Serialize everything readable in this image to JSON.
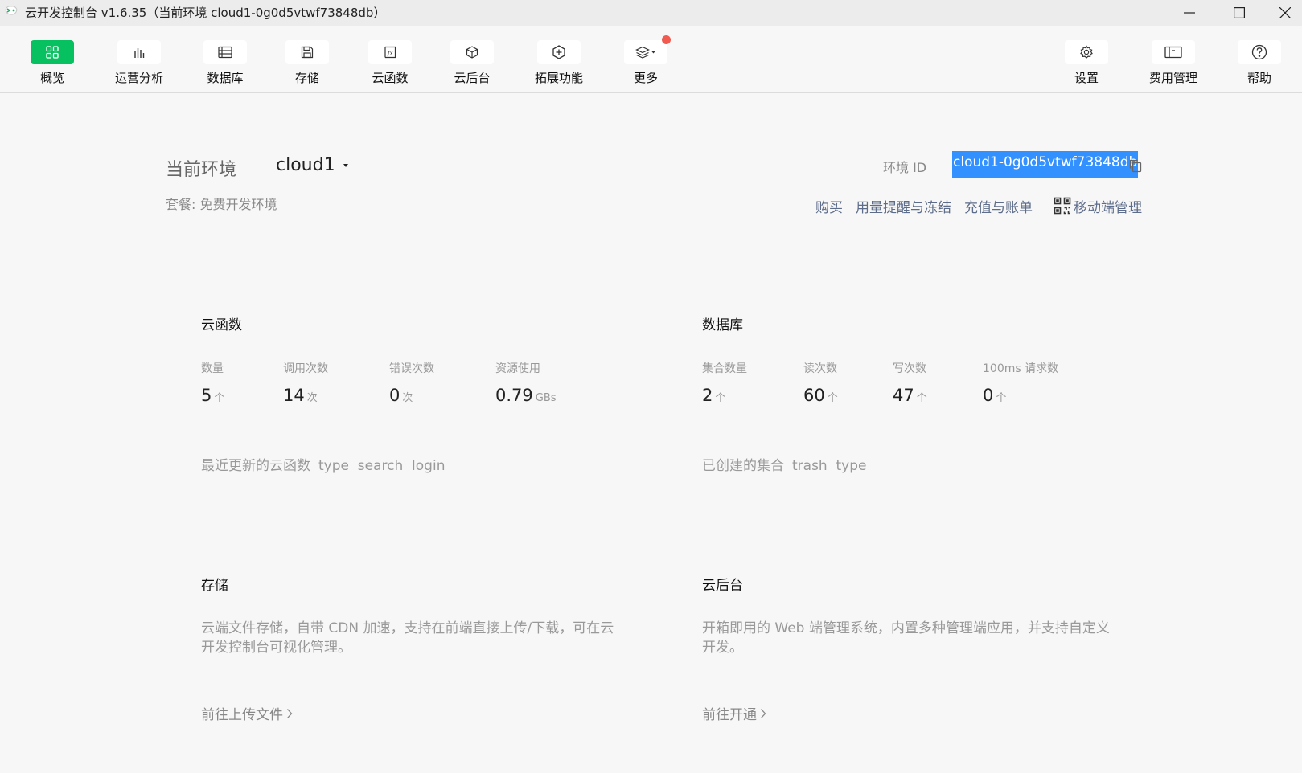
{
  "window": {
    "title": "云开发控制台 v1.6.35（当前环境 cloud1-0g0d5vtwf73848db）"
  },
  "toolbar": {
    "left_items": [
      {
        "label": "概览",
        "icon": "grid-icon",
        "active": true
      },
      {
        "label": "运营分析",
        "icon": "bar-chart-icon",
        "active": false
      },
      {
        "label": "数据库",
        "icon": "database-icon",
        "active": false
      },
      {
        "label": "存储",
        "icon": "floppy-icon",
        "active": false
      },
      {
        "label": "云函数",
        "icon": "function-icon",
        "active": false
      },
      {
        "label": "云后台",
        "icon": "cube-icon",
        "active": false
      },
      {
        "label": "拓展功能",
        "icon": "plus-box-icon",
        "active": false
      },
      {
        "label": "更多",
        "icon": "layers-icon",
        "active": false,
        "badge_dot": true
      }
    ],
    "right_items": [
      {
        "label": "设置",
        "icon": "gear-icon"
      },
      {
        "label": "费用管理",
        "icon": "billing-icon"
      },
      {
        "label": "帮助",
        "icon": "help-icon"
      }
    ],
    "accent": "#07c160",
    "badge_color": "#f05a4f"
  },
  "env": {
    "label": "当前环境",
    "name": "cloud1",
    "plan": "套餐: 免费开发环境",
    "id_label": "环境 ID",
    "id_value": "cloud1-0g0d5vtwf73848db",
    "actions": [
      "购买",
      "用量提醒与冻结",
      "充值与账单"
    ],
    "mobile_label": "移动端管理"
  },
  "functions": {
    "title": "云函数",
    "stats": [
      {
        "label": "数量",
        "value": "5",
        "unit": "个"
      },
      {
        "label": "调用次数",
        "value": "14",
        "unit": "次"
      },
      {
        "label": "错误次数",
        "value": "0",
        "unit": "次"
      },
      {
        "label": "资源使用",
        "value": "0.79",
        "unit": "GBs"
      }
    ],
    "recent_label": "最近更新的云函数",
    "recent_items": "type  search  login"
  },
  "database": {
    "title": "数据库",
    "stats": [
      {
        "label": "集合数量",
        "value": "2",
        "unit": "个"
      },
      {
        "label": "读次数",
        "value": "60",
        "unit": "个"
      },
      {
        "label": "写次数",
        "value": "47",
        "unit": "个"
      },
      {
        "label": "100ms 请求数",
        "value": "0",
        "unit": "个"
      }
    ],
    "recent_label": "已创建的集合",
    "recent_items": "trash  type"
  },
  "storage": {
    "title": "存储",
    "desc": "云端文件存储，自带 CDN 加速，支持在前端直接上传/下载，可在云开发控制台可视化管理。",
    "link": "前往上传文件"
  },
  "backend": {
    "title": "云后台",
    "desc": "开箱即用的 Web 端管理系统，内置多种管理端应用，并支持自定义开发。",
    "link": "前往开通"
  }
}
